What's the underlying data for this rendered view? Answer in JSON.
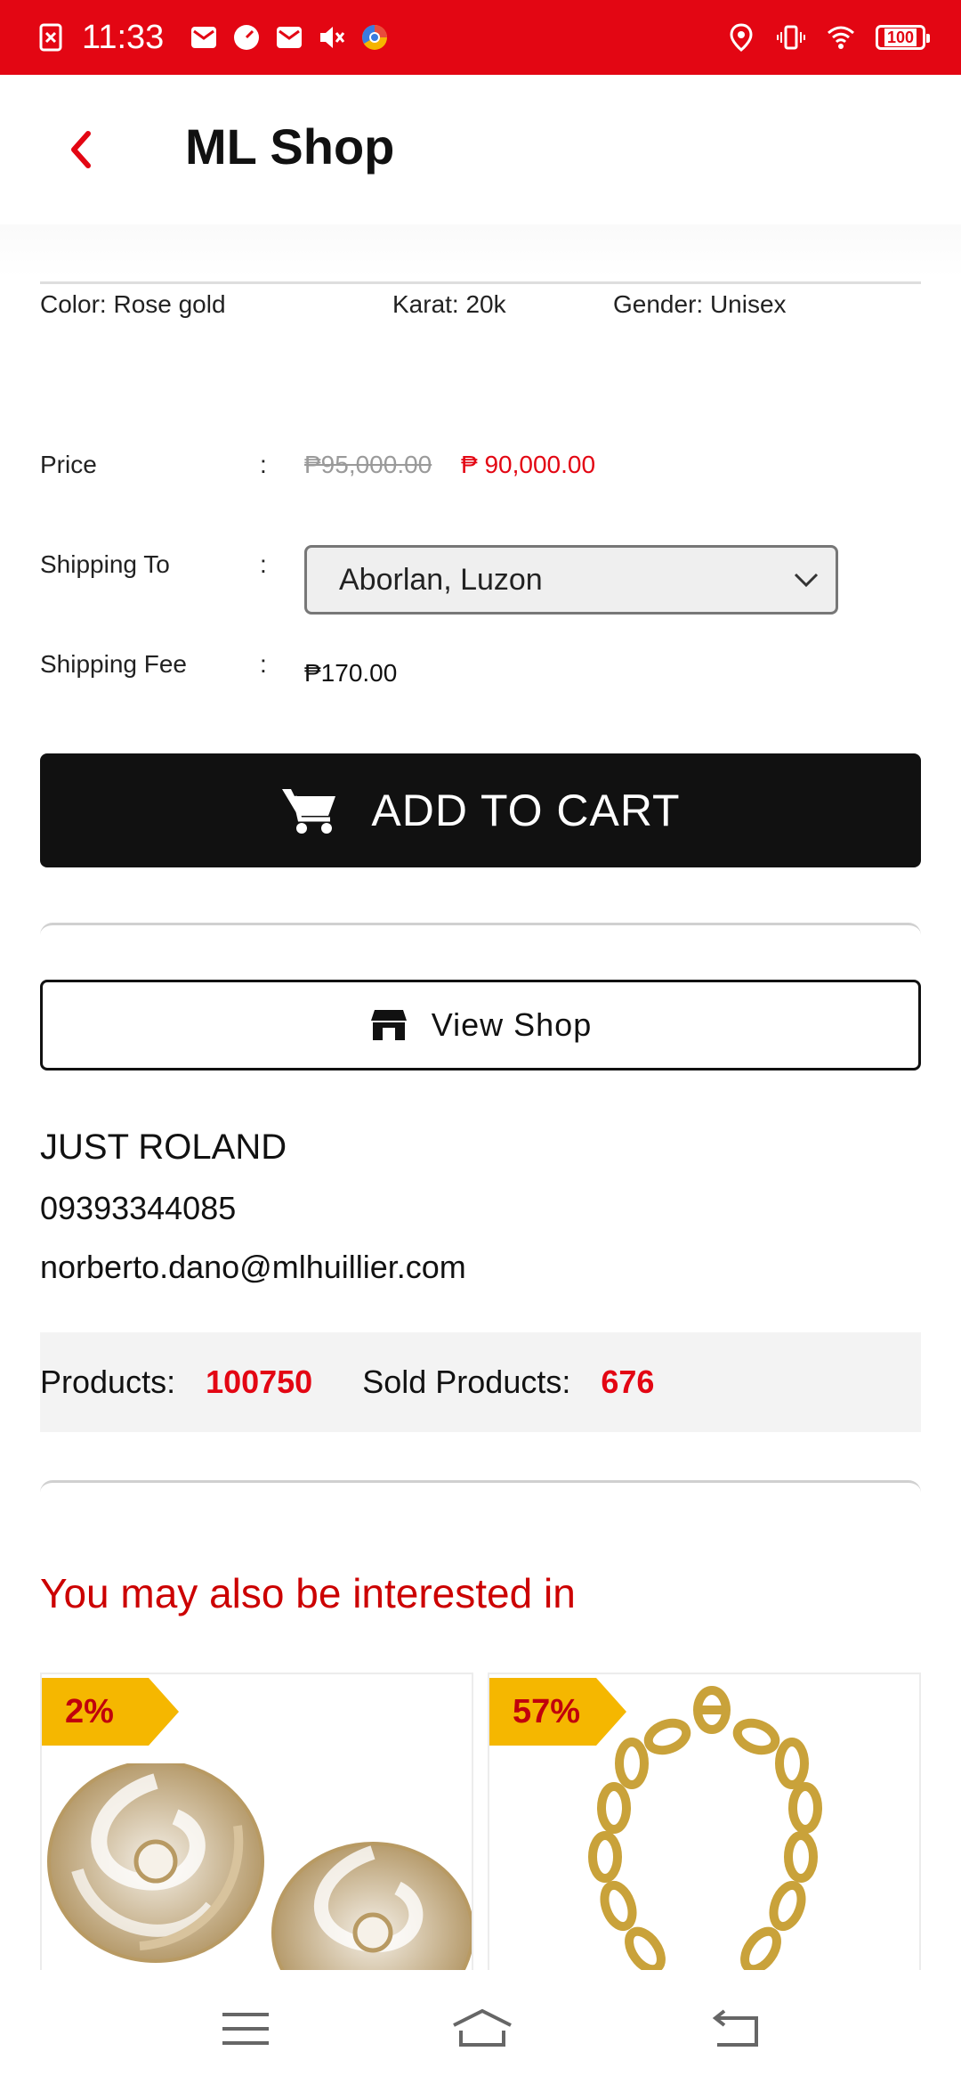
{
  "status_bar": {
    "time": "11:33",
    "battery": "100",
    "icons_left": [
      "x-box-icon",
      "mail-icon",
      "speed-icon",
      "mail-icon",
      "mute-icon",
      "chrome-icon"
    ],
    "icons_right": [
      "location-icon",
      "vibrate-icon",
      "wifi-icon",
      "battery-icon"
    ]
  },
  "header": {
    "title": "ML Shop",
    "accent_color": "#e30613"
  },
  "attributes": {
    "color": "Color: Rose gold",
    "karat": "Karat: 20k",
    "gender": "Gender: Unisex"
  },
  "price_row": {
    "label": "Price",
    "colon": ":",
    "old_price": "₱95,000.00",
    "new_price": "₱ 90,000.00"
  },
  "shipping_row": {
    "label": "Shipping To",
    "colon": ":",
    "selected": "Aborlan, Luzon"
  },
  "fee_row": {
    "label": "Shipping Fee",
    "colon": ":",
    "value": "₱170.00"
  },
  "add_to_cart": {
    "label": "ADD TO CART"
  },
  "view_shop": {
    "label": "View Shop"
  },
  "shop": {
    "name": "JUST ROLAND",
    "phone": "09393344085",
    "email": "norberto.dano@mlhuillier.com",
    "products_label": "Products:",
    "products_value": "100750",
    "sold_label": "Sold Products:",
    "sold_value": "676"
  },
  "recommendations": {
    "title": "You may also be interested in",
    "items": [
      {
        "discount": "2%"
      },
      {
        "discount": "57%"
      }
    ]
  }
}
